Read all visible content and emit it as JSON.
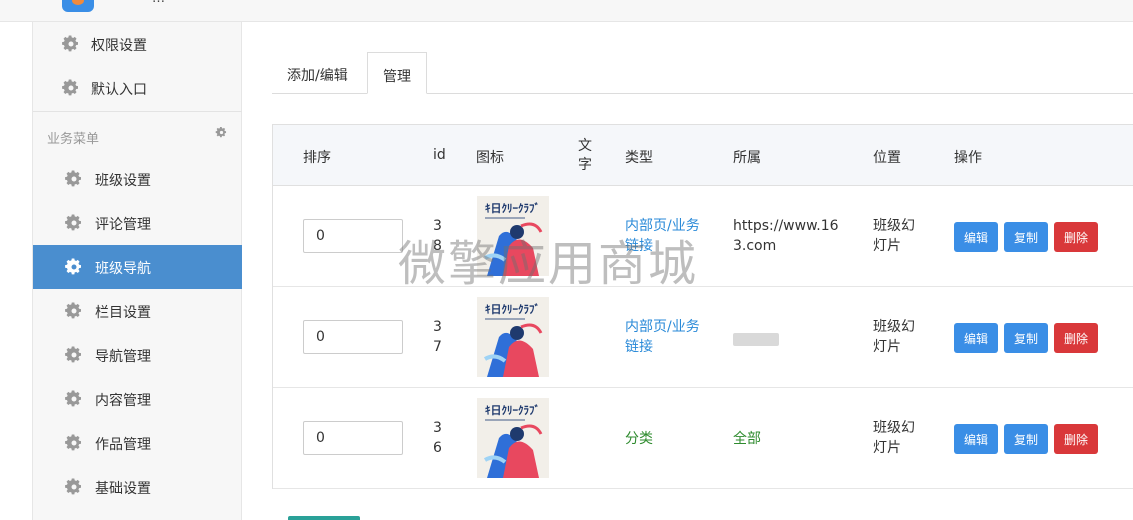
{
  "app": {
    "title": "…"
  },
  "sidebar": {
    "top_items": [
      {
        "label": "权限设置",
        "icon": "gear-icon"
      },
      {
        "label": "默认入口",
        "icon": "gear-icon"
      }
    ],
    "section_title": "业务菜单",
    "items": [
      {
        "label": "班级设置",
        "icon": "gear-icon"
      },
      {
        "label": "评论管理",
        "icon": "gear-icon"
      },
      {
        "label": "班级导航",
        "icon": "gear-icon",
        "active": true
      },
      {
        "label": "栏目设置",
        "icon": "gear-icon"
      },
      {
        "label": "导航管理",
        "icon": "gear-icon"
      },
      {
        "label": "内容管理",
        "icon": "gear-icon"
      },
      {
        "label": "作品管理",
        "icon": "gear-icon"
      },
      {
        "label": "基础设置",
        "icon": "gear-icon"
      }
    ]
  },
  "tabs": [
    {
      "label": "添加/编辑",
      "active": false
    },
    {
      "label": "管理",
      "active": true
    }
  ],
  "table": {
    "headers": {
      "sort": "排序",
      "id": "id",
      "icon": "图标",
      "text": "文字",
      "type": "类型",
      "belong": "所属",
      "position": "位置",
      "actions": "操作"
    },
    "rows": [
      {
        "sort": "0",
        "id": "38",
        "text": "",
        "type": "内部页/业务链接",
        "belong": "https://www.163.com",
        "position": "班级幻灯片"
      },
      {
        "sort": "0",
        "id": "37",
        "text": "",
        "type": "内部页/业务链接",
        "belong": "",
        "position": "班级幻灯片"
      },
      {
        "sort": "0",
        "id": "36",
        "text": "",
        "type": "分类",
        "belong": "全部",
        "position": "班级幻灯片"
      }
    ],
    "actions": {
      "edit": "编辑",
      "copy": "复制",
      "delete": "删除"
    }
  },
  "thumbnail_text": "ｷ日ｸﾘｰｸﾗﾌﾞ",
  "watermark": "微擎应用商城",
  "colors": {
    "accent": "#4a8ecf",
    "link": "#2a8ad8",
    "green": "#2e8b2e",
    "danger": "#d9383a",
    "button": "#3a8ee6"
  }
}
